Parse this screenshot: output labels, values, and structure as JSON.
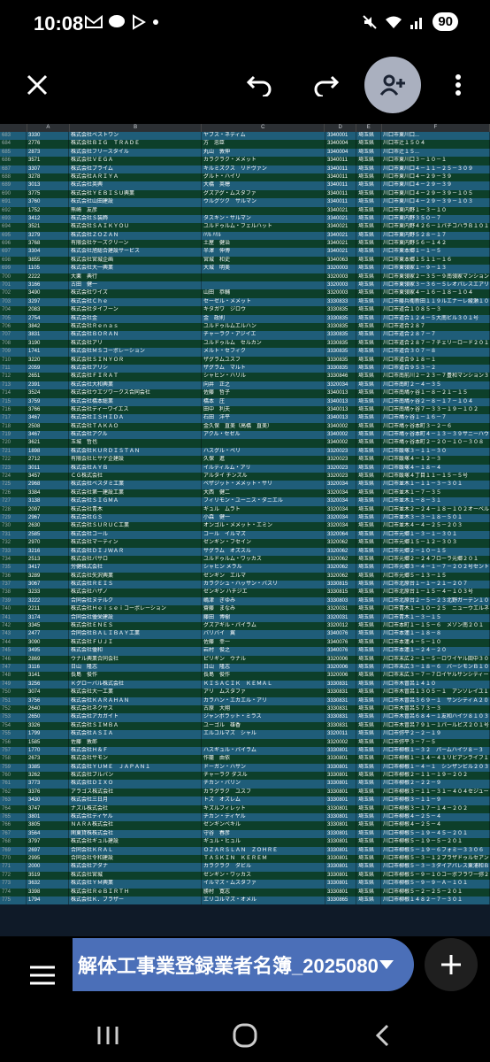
{
  "status": {
    "time": "10:08",
    "battery": "90"
  },
  "columns": [
    "A",
    "B",
    "C",
    "D",
    "E",
    "F"
  ],
  "rows": [
    [
      "683",
      "3330",
      "株式会社ベストワン",
      "ヤブス・ネディム",
      "3340001",
      "埼玉県",
      "川口市東川口..."
    ],
    [
      "684",
      "2776",
      "株式会社ＢＩＧ　ＴＲＡＤＥ",
      "方　忠臣",
      "3340004",
      "埼玉県",
      "川口市辻１５０４"
    ],
    [
      "685",
      "2873",
      "株式会社フリースタイル",
      "丸山　敦伸",
      "3340004",
      "埼玉県",
      "川口市辻１５..."
    ],
    [
      "686",
      "3571",
      "株式会社ＶＥＧＡ",
      "カラクラク・メメット",
      "3340011",
      "埼玉県",
      "川口市東川口３－１０－１"
    ],
    [
      "687",
      "3307",
      "株式会社プライム",
      "キルミズクス　リドヴァン",
      "3340011",
      "埼玉県",
      "川口市東川口４－１１－２５－３０９"
    ],
    [
      "688",
      "3278",
      "株式会社ＡＲＩＹＡ",
      "グルト・ハイリ",
      "3340011",
      "埼玉県",
      "川口市東川口４－２９－３９"
    ],
    [
      "689",
      "3013",
      "株式会社英興",
      "大橋　英穂",
      "3340011",
      "埼玉県",
      "川口市東川口４－２９－３９"
    ],
    [
      "690",
      "3775",
      "株式会社ＹＥＢＩＳＵ興業",
      "グズアグ・ムスタファ",
      "3340011",
      "埼玉県",
      "川口市東川口４－２９－３９－１０５"
    ],
    [
      "691",
      "3760",
      "株式会社山田建設",
      "ウルグツク　サルマン",
      "3340011",
      "埼玉県",
      "川口市東川口４－２９－３９－１０３"
    ],
    [
      "692",
      "1752",
      "熊崎　友彦",
      "",
      "3340021",
      "埼玉県",
      "川口市東内野１－３－１０"
    ],
    [
      "693",
      "3412",
      "株式会社Ｓ装飾",
      "タスキン・サルマン",
      "3340021",
      "埼玉県",
      "川口市東内野３５０－７"
    ],
    [
      "694",
      "3521",
      "株式会社ＳＡＩＫＹＯＵ",
      "ユルドゥルム・フェルハット",
      "3340021",
      "埼玉県",
      "川口市東内野４２６－１パチコハラＢ１０１"
    ],
    [
      "695",
      "3279",
      "株式会社ＺＯＺＡＮ",
      "ﾊﾘﾙ ﾊﾘﾙ",
      "3340021",
      "埼玉県",
      "川口市東内野５２８－１７"
    ],
    [
      "696",
      "3768",
      "有限会社ケーズクリーン",
      "土屋　健治",
      "3340021",
      "埼玉県",
      "川口市東内野５６－１４２"
    ],
    [
      "697",
      "3304",
      "株式会社旭総合建設サービス",
      "半澤　伸博",
      "3340021",
      "埼玉県",
      "川口市東本郷１－１－５"
    ],
    [
      "698",
      "3855",
      "株式会社宮城企画",
      "宮城　和史",
      "3340063",
      "埼玉県",
      "川口市東本郷１５１１－１６"
    ],
    [
      "699",
      "1105",
      "株式会社大一興業",
      "大城　明美",
      "3320003",
      "埼玉県",
      "川口市東領家１－９－１３"
    ],
    [
      "700",
      "2222",
      "大栗　典行",
      "",
      "3320003",
      "埼玉県",
      "川口市東領家２－３５－９南領家マンション３０１"
    ],
    [
      "701",
      "3166",
      "古田　健一",
      "",
      "3320003",
      "埼玉県",
      "川口市東領家３－３６－５レオパレスエアリア２０２"
    ],
    [
      "702",
      "3490",
      "株式会社ワイズ",
      "山田　恭輔",
      "3320003",
      "埼玉県",
      "川口市東領家４－１６－１８－１０４"
    ],
    [
      "703",
      "3297",
      "株式会社Ｃｈｅ",
      "セーゼル・メメット",
      "3330833",
      "埼玉県",
      "川口市藤兵衛新田１１９ルエナーレ綾瀬１０１号"
    ],
    [
      "704",
      "2083",
      "株式会社タイフーン",
      "キタガワ　ジロウ",
      "3330835",
      "埼玉県",
      "川口市道合１０８５－３"
    ],
    [
      "705",
      "2754",
      "株式会社金",
      "金　政則",
      "3330835",
      "埼玉県",
      "川口市道合１２４－５大南ビル３０１号"
    ],
    [
      "706",
      "3842",
      "株式会社Ｒｅｎａｓ",
      "ユルドゥルムエルハン",
      "3330835",
      "埼玉県",
      "川口市道合２８７"
    ],
    [
      "707",
      "3831",
      "株式会社ＢＯＲＡＮ",
      "チャーラク・アジイエ",
      "3330835",
      "埼玉県",
      "川口市道合２８７－７"
    ],
    [
      "708",
      "3190",
      "株式会社アリ",
      "ユルドゥルム　セルカン",
      "3330835",
      "埼玉県",
      "川口市道合２８７－７チェリーロード２０１号室"
    ],
    [
      "709",
      "1741",
      "株式会社ＭＳコーポレーション",
      "メルト・セフィク",
      "3330835",
      "埼玉県",
      "川口市道合３０７－８"
    ],
    [
      "710",
      "3220",
      "株式会社ＳＩＮＹＯＲ",
      "ザグラムユスフ",
      "3330835",
      "埼玉県",
      "川口市道合９１８－１"
    ],
    [
      "711",
      "2059",
      "株式会社アリシ",
      "ザグラム　マルト",
      "3330835",
      "埼玉県",
      "川口市道合９５３－２"
    ],
    [
      "712",
      "2651",
      "株式会社ＦＩＲＡＴ",
      "シャヒン・ハリル",
      "3330846",
      "埼玉県",
      "川口市南前川２－２３－７豊和マンション３０１"
    ],
    [
      "713",
      "2391",
      "株式会社大和興業",
      "向井　正之",
      "3320034",
      "埼玉県",
      "川口市南町２－４－３５"
    ],
    [
      "714",
      "3524",
      "株式会社ウエヅワークス合同会社",
      "佐藤　哲子",
      "3340013",
      "埼玉県",
      "川口市南鳩ヶ谷１－８－２１－１５"
    ],
    [
      "715",
      "3759",
      "株式会社橋本総業",
      "橋本　圧",
      "3340013",
      "埼玉県",
      "川口市南鳩ヶ谷２－８－１７－１０４"
    ],
    [
      "716",
      "3766",
      "株式会社ディーワイエス",
      "田中　利夫",
      "3340013",
      "埼玉県",
      "川口市南鳩ヶ谷７－３３－１９－１０２"
    ],
    [
      "717",
      "3467",
      "株式会社ＩＳＨＩＤＡ",
      "石田　洋平",
      "3340013",
      "埼玉県",
      "川口市鳩ヶ谷１－１６－７"
    ],
    [
      "718",
      "2508",
      "株式会社ＴＡＫＡＯ",
      "金久保　直美（高橋　直美）",
      "3340002",
      "埼玉県",
      "川口市鳩ヶ谷本町３－２－６"
    ],
    [
      "719",
      "3467",
      "株式会社アクル",
      "アクル・セゼル",
      "3340002",
      "埼玉県",
      "川口市鳩ヶ谷本町４－１３－３９サニーハウス１０１"
    ],
    [
      "720",
      "3621",
      "玉城　哲也",
      "",
      "3340002",
      "埼玉県",
      "川口市鳩ヶ谷本町２－２０－１０－３０８"
    ],
    [
      "721",
      "1898",
      "株式会社ＫＵＲＤＩＳＴＡＮ",
      "ハスグル・ベリ",
      "3320023",
      "埼玉県",
      "川口市飯塚３－１１－３０"
    ],
    [
      "722",
      "2712",
      "有限会社ヒサゲ企建設",
      "久保　進",
      "3320023",
      "埼玉県",
      "川口市飯塚４－１２－３"
    ],
    [
      "723",
      "3011",
      "株式会社ＡＹＢ",
      "イルディルム・アリ",
      "3320023",
      "埼玉県",
      "川口市飯塚４－１８－４"
    ],
    [
      "724",
      "3457",
      "ＣＧ株式会社",
      "アルタイ チンズル",
      "3320023",
      "埼玉県",
      "川口市飯塚４丁目１１－１５－５号"
    ],
    [
      "725",
      "2968",
      "株式会社ベスダミ工業",
      "ベザジット・メメット・サリ",
      "3320034",
      "埼玉県",
      "川口市並木１－１１－３－３０１"
    ],
    [
      "726",
      "3384",
      "株式会社第一建設工業",
      "大西　健二",
      "3320034",
      "埼玉県",
      "川口市並木１－７－３５"
    ],
    [
      "727",
      "3138",
      "株式会社ＳＩＧＭＡ",
      "フィリモン・ユーニス・ダニエル",
      "3320034",
      "埼玉県",
      "川口市並木１－８－３１"
    ],
    [
      "728",
      "2097",
      "株式会社青木",
      "ギュル　ムラト",
      "3320034",
      "埼玉県",
      "川口市並木２－２４－１８－１０２オーベル..."
    ],
    [
      "729",
      "2967",
      "株式会社ＧＳ",
      "小森　健一",
      "3320034",
      "埼玉県",
      "川口市並木３－３－１８－５０１"
    ],
    [
      "730",
      "2630",
      "株式会社ＳＵＲＵＣ工業",
      "オンゴル・メメット・エミン",
      "3320034",
      "埼玉県",
      "川口市並木４－４－２５－２０３"
    ],
    [
      "731",
      "2585",
      "株式会社コール",
      "コール　イルマズ",
      "3320064",
      "埼玉県",
      "川口市元郷１－３－１－３０１"
    ],
    [
      "732",
      "2970",
      "株式会社マーティン",
      "ゼンギン・フセイン",
      "3320062",
      "埼玉県",
      "川口市元郷１５－１２－３０３"
    ],
    [
      "733",
      "3216",
      "株式会社ＤＩＪＷＡＲ",
      "サグラム　オズスル",
      "3320062",
      "埼玉県",
      "川口市元郷２－１０－１５"
    ],
    [
      "734",
      "2513",
      "株式会社パサロ",
      "ユルドゥルム・ワッカス",
      "3320062",
      "埼玉県",
      "川口市元郷２－２４フローラ元郷２０１"
    ],
    [
      "735",
      "3417",
      "労健株式会社",
      "シャヒン メラル",
      "3320062",
      "埼玉県",
      "川口市元郷３－４－１－７－２０２号セントヒルズ"
    ],
    [
      "736",
      "3289",
      "株式会社矢沢興業",
      "ゼンギン　エルマ",
      "3320062",
      "埼玉県",
      "川口市元郷５－１３－１５"
    ],
    [
      "737",
      "3067",
      "株式会社ＲＥＩＳ",
      "カラクシュ・ハッサン・バスリ",
      "3330815",
      "埼玉県",
      "川口市北原台１－１－２１－２０７"
    ],
    [
      "738",
      "3233",
      "株式会社ハザノ",
      "ゼンギン ハチジエ",
      "3330815",
      "埼玉県",
      "川口市北原台１－１５－４－１０３号"
    ],
    [
      "739",
      "3222",
      "合同会社ヌテルク",
      "嶋津　ぎゆみ",
      "3330803",
      "埼玉県",
      "川口市北原台２－５－２３北野ガーデン１０１"
    ],
    [
      "740",
      "2211",
      "株式会社Ｈｅｉｓｅｉコーポレーション",
      "齋藤　まなみ",
      "3320031",
      "埼玉県",
      "川口市青木１－１０－２５　ニューウエルネス１０"
    ],
    [
      "741",
      "3174",
      "合同会社優栄建設",
      "藤田　博樹",
      "3320031",
      "埼玉県",
      "川口市青木１－３－１５"
    ],
    [
      "742",
      "3345",
      "株式会社ＥＮＥＳ",
      "グズアギル・パイラム",
      "3320012",
      "埼玉県",
      "川口市本町１－１５－６　メゾン南２０１"
    ],
    [
      "743",
      "2477",
      "合同会社ＢＡＬＩＢＡＹ工業",
      "バリバイ　翼",
      "3340076",
      "埼玉県",
      "川口市本蓮１－１８－８"
    ],
    [
      "744",
      "3090",
      "株式会社ＦＵＪＩ",
      "佐藤　幸一",
      "3340076",
      "埼玉県",
      "川口市本蓮４－５－１０"
    ],
    [
      "745",
      "3495",
      "株式会社優和",
      "岩村　俊之",
      "3340076",
      "埼玉県",
      "川口市本蓮１－２４－２０"
    ],
    [
      "746",
      "2869",
      "ウナル興業合同会社",
      "ピリギン　ウナル",
      "3320006",
      "埼玉県",
      "川口市末広２－１－５－ロワイヤル田中３０５"
    ],
    [
      "747",
      "3116",
      "日山　隆志",
      "日山　隆志",
      "3320006",
      "埼玉県",
      "川口市末広３－１８－６　バーシモンＢ１０１"
    ],
    [
      "748",
      "3141",
      "長島　俊作",
      "長島　俊作",
      "3320006",
      "埼玉県",
      "川口市末広３－７－７ロイヤルサンシティー７０"
    ],
    [
      "749",
      "3256",
      "Ｋグローバル株式会社",
      "ＫＩＳＡＣＩＫ　ＫＥＭＡＬ",
      "3330831",
      "埼玉県",
      "川口市木曽呂１４１０"
    ],
    [
      "750",
      "3074",
      "株式会社大一工業",
      "アリ　ムスタファ",
      "3330831",
      "埼玉県",
      "川口市木曽呂１３０５－１　アンソレイユ１０２号"
    ],
    [
      "751",
      "3756",
      "株式会社ＫＡＲＡＨＡＮ",
      "カラハン・エカエル・アリ",
      "3330831",
      "埼玉県",
      "川口市木曽呂３６９－１　サンシティＡ２０２"
    ],
    [
      "752",
      "2640",
      "株式会社ネクサス",
      "古原　大翔",
      "3330831",
      "埼玉県",
      "川口市木曽呂５７３－３"
    ],
    [
      "753",
      "2650",
      "株式会社アカガイト",
      "ジャンボラット・ミラス",
      "3330831",
      "埼玉県",
      "川口市木曽呂６８４－１友和ハイツ８１０３"
    ],
    [
      "754",
      "3326",
      "株式会社ＳＩＭＢＡ",
      "ユーゴル　雄香",
      "3330831",
      "埼玉県",
      "川口市木曽呂７９１－１パールビズ２０１号"
    ],
    [
      "755",
      "1799",
      "株式会社ＡＳＩＡ",
      "エルコルマズ　シャル",
      "3320011",
      "埼玉県",
      "川口市弥平２－２－１９"
    ],
    [
      "756",
      "1585",
      "佐藤　敦郎",
      "",
      "3320002",
      "埼玉県",
      "川口市弥平３－７－５"
    ],
    [
      "757",
      "1770",
      "株式会社Ｈ＆Ｆ",
      "ハスギュル・バイラム",
      "3330801",
      "埼玉県",
      "川口市柳根１－３２　パームハイツ８－３"
    ],
    [
      "758",
      "2673",
      "株式会社サモン",
      "作籠　由依",
      "3330801",
      "埼玉県",
      "川口市柳根１－１４－４１リビアンライフ１０"
    ],
    [
      "759",
      "3385",
      "株式会社ＹＵＭＥ　ＪＡＰＡＮ１",
      "ドーガン・ハサン",
      "3330801",
      "埼玉県",
      "川口市柳根１－４－１　シンザンビル２０３号"
    ],
    [
      "760",
      "3262",
      "株式会社ブルバン",
      "チャーラク ダスル",
      "3330801",
      "埼玉県",
      "川口市柳根２－１１－１９－２０２"
    ],
    [
      "761",
      "3773",
      "株式会社ＤＩＸＯ",
      "チカン・バリン",
      "3330801",
      "埼玉県",
      "川口市柳根２－２２－９"
    ],
    [
      "762",
      "3376",
      "アラゴス株式会社",
      "カラグラク　ユスフ",
      "3330801",
      "埼玉県",
      "川口市柳根３－１１－３１－４０４セジュール柳根"
    ],
    [
      "763",
      "3430",
      "株式会社三日月",
      "トズ　オズレム",
      "3330801",
      "埼玉県",
      "川口市柳根３－１１－９"
    ],
    [
      "764",
      "3747",
      "ナズル株式会社",
      "キズルフィレット",
      "3330801",
      "埼玉県",
      "川口市柳根３－１７－１４－２０２"
    ],
    [
      "765",
      "3801",
      "株式会社ディヤル",
      "チカン・ディヤル",
      "3330801",
      "埼玉県",
      "川口市柳根４－２５－４"
    ],
    [
      "766",
      "3805",
      "ＮＡＲＡ株式会社",
      "ゼンギンベキル",
      "3330801",
      "埼玉県",
      "川口市柳根４－２５－４"
    ],
    [
      "767",
      "3564",
      "関東貸株株式会社",
      "守谷　春彦",
      "3330801",
      "埼玉県",
      "川口市柳根５－１９－４５－２０１"
    ],
    [
      "768",
      "3797",
      "株式会社ギュル建設",
      "ギュル・ヒュル",
      "3330801",
      "埼玉県",
      "川口市柳根５－１９－５－２０１"
    ],
    [
      "769",
      "2697",
      "合同会社ＫＲＡＬ",
      "ＯＺＡＲＳＬＡＮ　ＺＯＨＲＥ",
      "3330801",
      "埼玉県",
      "川口市柳根５－１９－６フォミー３３０６"
    ],
    [
      "770",
      "2995",
      "合同会社令和建設",
      "ＴＡＳＫＩＮ　ＫＥＲＥＭ",
      "3330801",
      "埼玉県",
      "川口市柳根５－３－１２プラザドゥルセアン２０"
    ],
    [
      "771",
      "2000",
      "株式会社アダナ",
      "カラクラク　ダビル",
      "3330801",
      "埼玉県",
      "川口市柳根５－３－３ダイアパレス東浦和Ｂ１０"
    ],
    [
      "772",
      "3519",
      "株式会社宮城",
      "ゼンギン・ワッカス",
      "3330801",
      "埼玉県",
      "川口市柳根５－９－１０コーポフラワー弥２０５"
    ],
    [
      "773",
      "3632",
      "株式会社ＹＭ興業",
      "イルマズ・ムスタファ",
      "3330801",
      "埼玉県",
      "川口市柳根５－９－９－Ａ－１０１"
    ],
    [
      "774",
      "3398",
      "株式会社ＲｅＢＩＲＴＨ",
      "勝村　寛志",
      "3330801",
      "埼玉県",
      "川口市柳根５－２－２５－２０１"
    ],
    [
      "775",
      "1794",
      "株式会社Ｋ．ブラザー",
      "エリコルマズ・オメル",
      "3330865",
      "埼玉県",
      "川口市柳根１４８２－７－３０１"
    ]
  ],
  "file": {
    "name": "解体工事業登録業者名簿_20250806..."
  },
  "icons": {
    "close": "close-icon",
    "undo": "undo-icon",
    "redo": "redo-icon",
    "add_person": "person-add-icon",
    "more": "more-vert-icon",
    "menu": "hamburger-menu-icon",
    "dropdown": "dropdown-triangle-icon",
    "add": "plus-icon"
  }
}
